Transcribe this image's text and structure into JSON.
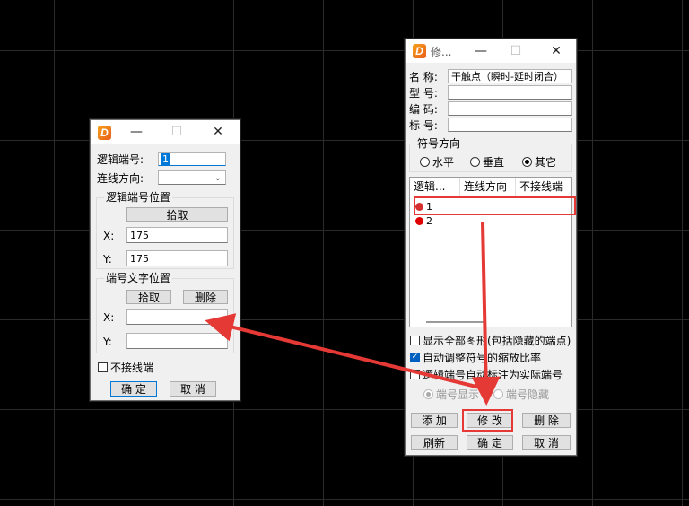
{
  "left_dialog": {
    "fields": {
      "logic_no_label": "逻辑端号:",
      "logic_no_value": "1",
      "direction_label": "连线方向:",
      "direction_value": ""
    },
    "group_pos": {
      "title": "逻辑端号位置",
      "pick_label": "拾取",
      "x_label": "X:",
      "x_value": "175",
      "y_label": "Y:",
      "y_value": "175"
    },
    "group_text": {
      "title": "端号文字位置",
      "pick_label": "拾取",
      "delete_label": "删除",
      "x_label": "X:",
      "x_value": "",
      "y_label": "Y:",
      "y_value": ""
    },
    "no_wire_label": "不接线端",
    "ok_label": "确  定",
    "cancel_label": "取  消"
  },
  "right_dialog": {
    "title": "修...",
    "fields": [
      {
        "label": "名 称:",
        "value": "干触点（瞬时-延时闭合）"
      },
      {
        "label": "型 号:",
        "value": ""
      },
      {
        "label": "编 码:",
        "value": ""
      },
      {
        "label": "标 号:",
        "value": ""
      }
    ],
    "symbol_dir": {
      "title": "符号方向",
      "options": [
        "水平",
        "垂直",
        "其它"
      ],
      "selected": "其它"
    },
    "table": {
      "columns": [
        "逻辑...",
        "连线方向",
        "不接线端"
      ],
      "rows": [
        {
          "no": "1",
          "color": "#d32f2f"
        },
        {
          "no": "2",
          "color": "#e00000"
        }
      ]
    },
    "checks": [
      {
        "label": "显示全部图形(包括隐藏的端点)",
        "checked": false
      },
      {
        "label": "自动调整符号的缩放比率",
        "checked": true
      },
      {
        "label": "逻辑端号自动标注为实际端号",
        "checked": false
      }
    ],
    "radios_disabled": [
      "端号显示",
      "端号隐藏"
    ],
    "buttons": {
      "add": "添 加",
      "modify": "修 改",
      "delete": "删 除",
      "refresh": "刷新",
      "ok": "确 定",
      "cancel": "取 消"
    }
  },
  "colors": {
    "highlight": "#e53935",
    "accent": "#0078d7"
  }
}
